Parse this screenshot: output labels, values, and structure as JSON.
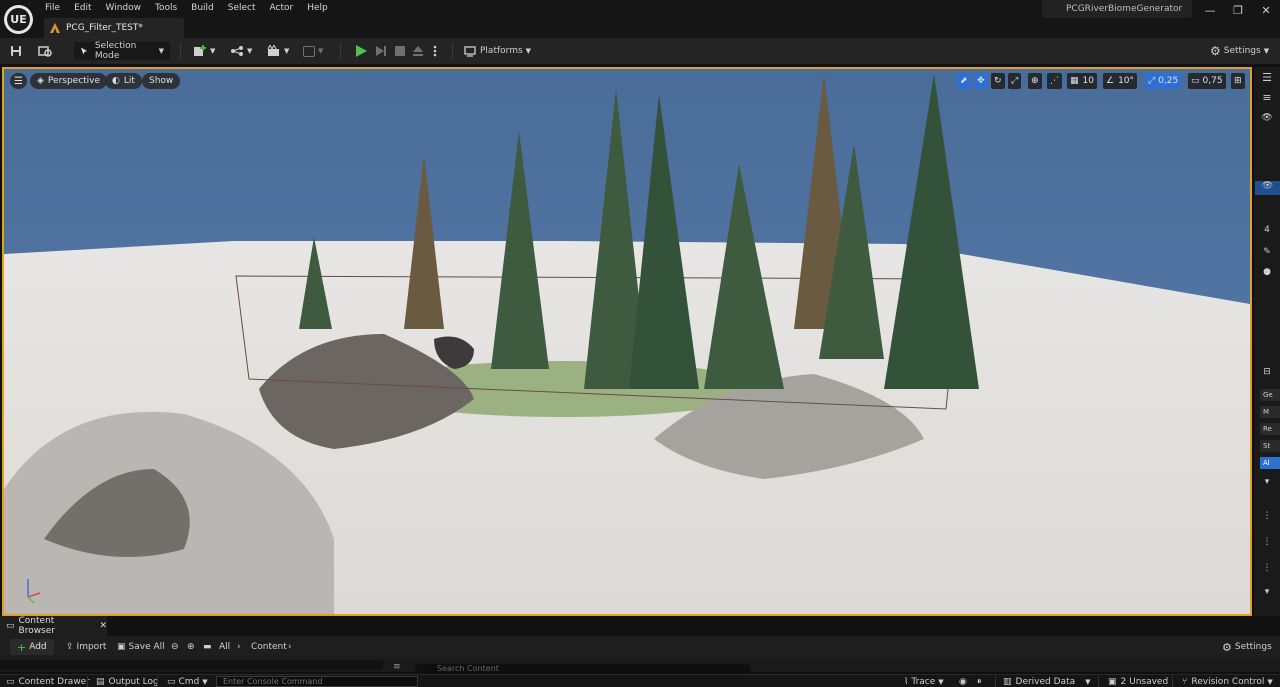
{
  "app": {
    "logo": "UE",
    "menu": [
      "File",
      "Edit",
      "Window",
      "Tools",
      "Build",
      "Select",
      "Actor",
      "Help"
    ],
    "doc_tab": "PCG_Filter_TEST*",
    "project": "PCGRiverBiomeGenerator",
    "window_buttons": [
      "—",
      "❐",
      "✕"
    ]
  },
  "toolbar": {
    "mode": "Selection Mode",
    "platforms": "Platforms",
    "settings": "Settings",
    "icons": [
      "save-icon",
      "browse-icon",
      "add-actor-icon",
      "snap-icon",
      "cinematics-icon",
      "play-icon",
      "step-icon",
      "stop-icon",
      "eject-icon",
      "options-icon"
    ]
  },
  "viewport": {
    "perspective": "Perspective",
    "lit": "Lit",
    "show": "Show",
    "grid_snap": "10",
    "rot_snap": "10°",
    "scale_snap": "0,25",
    "camera_speed": "0,75",
    "sky_color": "#4f74a3",
    "snow_color": "#e4e2e0",
    "selection_color": "#e0a11b"
  },
  "right_panel": {
    "eye": "👁",
    "num": "4",
    "buttons": [
      "Ge",
      "M",
      "Re",
      "St",
      "Al"
    ]
  },
  "content_browser": {
    "tab": "Content Browser",
    "add": "Add",
    "import": "Import",
    "save_all": "Save All",
    "all": "All",
    "content": "Content",
    "settings": "Settings",
    "search_placeholder": "Search Content"
  },
  "statusbar": {
    "content_drawer": "Content Drawer",
    "output_log": "Output Log",
    "cmd": "Cmd",
    "console_placeholder": "Enter Console Command",
    "trace": "Trace",
    "derived_data": "Derived Data",
    "unsaved": "2 Unsaved",
    "revision_control": "Revision Control"
  }
}
